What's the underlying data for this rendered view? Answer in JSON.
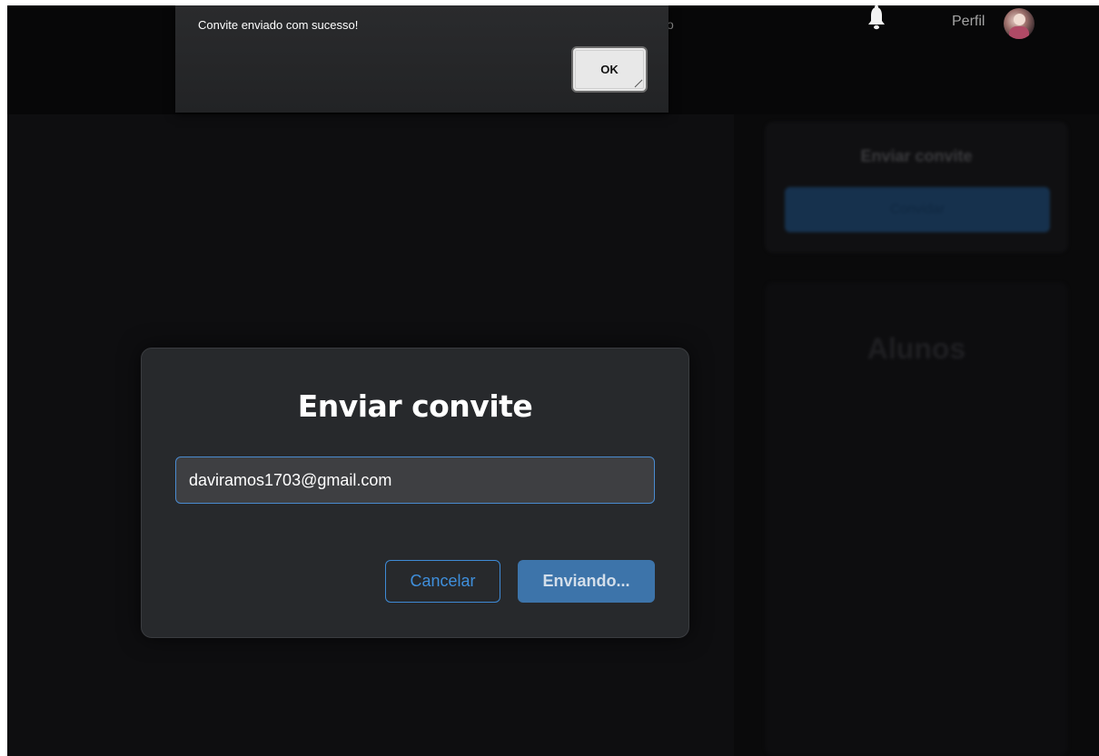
{
  "header": {
    "nav_fragment": "o",
    "bell_icon": "bell-icon",
    "profile_label": "Perfil"
  },
  "alert": {
    "message": "Convite enviado com sucesso!",
    "ok_label": "OK"
  },
  "sidebar": {
    "invite_card_title": "Enviar convite",
    "invite_card_button": "Convidar",
    "students_card_title": "Alunos"
  },
  "modal": {
    "title": "Enviar convite",
    "email_value": "daviramos1703@gmail.com",
    "cancel_label": "Cancelar",
    "send_label": "Enviando..."
  },
  "colors": {
    "accent": "#3d74aa",
    "accent_border": "#3e8ad6",
    "background": "#0c0c0d",
    "modal_bg": "#27292c"
  }
}
